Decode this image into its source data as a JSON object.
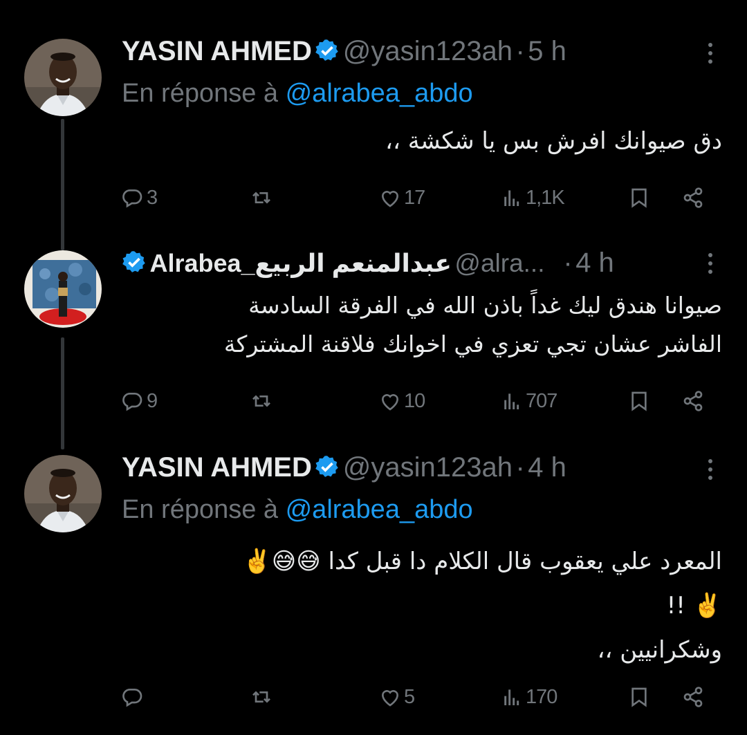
{
  "tweets": [
    {
      "name": "YASIN AHMED",
      "handle": "@yasin123ah",
      "dot": "·",
      "time": "5 h",
      "reply_prefix": "En réponse à ",
      "reply_mention": "@alrabea_abdo",
      "lines": [
        "دق صيوانك  افرش بس يا شكشة ،،"
      ],
      "replies": "3",
      "retweets": "",
      "likes": "17",
      "views": "1,1K"
    },
    {
      "name": "Alrabea_عبدالمنعم الربيع",
      "handle": "@alra...",
      "dot": "·",
      "time": "4 h",
      "lines": [
        "صيوانا هندق ليك غداً باذن الله في الفرقة السادسة",
        "الفاشر عشان تجي تعزي في اخوانك فلاقنة المشتركة"
      ],
      "replies": "9",
      "retweets": "",
      "likes": "10",
      "views": "707"
    },
    {
      "name": "YASIN AHMED",
      "handle": "@yasin123ah",
      "dot": "·",
      "time": "4 h",
      "reply_prefix": "En réponse à ",
      "reply_mention": "@alrabea_abdo",
      "lines": [
        "المعرد علي يعقوب قال الكلام دا قبل كدا 😅😅✌️",
        "✌️ !!",
        "وشكرانيين ،،"
      ],
      "replies": "",
      "retweets": "",
      "likes": "5",
      "views": "170"
    }
  ],
  "colors": {
    "background": "#000000",
    "text": "#e7e9ea",
    "muted": "#71767b",
    "accent": "#1d9bf0",
    "thread_line": "#333639"
  },
  "icons": [
    "reply-icon",
    "retweet-icon",
    "like-icon",
    "views-icon",
    "bookmark-icon",
    "share-icon",
    "verified-badge-icon",
    "more-icon"
  ]
}
